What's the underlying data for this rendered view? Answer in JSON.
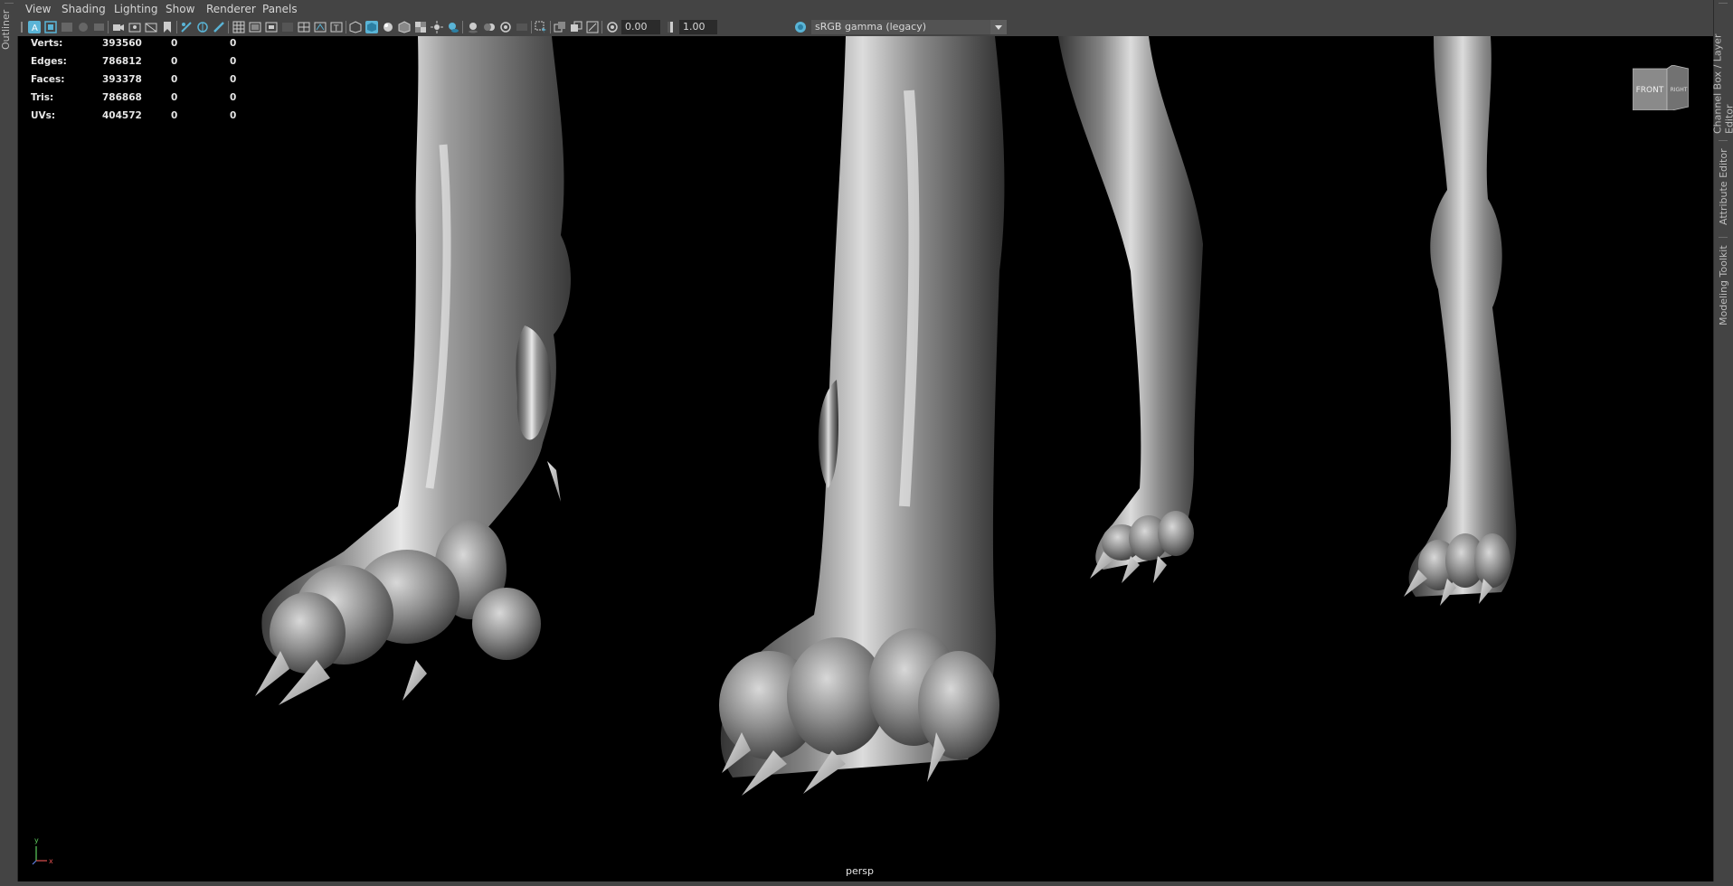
{
  "left_panel": {
    "outliner_label": "Outliner"
  },
  "right_panel": {
    "tabs": [
      {
        "label": "Channel Box / Layer Editor"
      },
      {
        "label": "Attribute Editor"
      },
      {
        "label": "Modeling Toolkit"
      }
    ]
  },
  "menubar": {
    "items": [
      {
        "label": "View"
      },
      {
        "label": "Shading"
      },
      {
        "label": "Lighting"
      },
      {
        "label": "Show"
      },
      {
        "label": "Renderer"
      },
      {
        "label": "Panels"
      }
    ]
  },
  "toolbar": {
    "exposure_value": "0.00",
    "gamma_value": "1.00",
    "color_space": "sRGB gamma (legacy)",
    "accent_color": "#5ab4d6"
  },
  "hud": {
    "rows": [
      {
        "label": "Verts:",
        "total": "393560",
        "selected": "0",
        "components": "0"
      },
      {
        "label": "Edges:",
        "total": "786812",
        "selected": "0",
        "components": "0"
      },
      {
        "label": "Faces:",
        "total": "393378",
        "selected": "0",
        "components": "0"
      },
      {
        "label": "Tris:",
        "total": "786868",
        "selected": "0",
        "components": "0"
      },
      {
        "label": "UVs:",
        "total": "404572",
        "selected": "0",
        "components": "0"
      }
    ]
  },
  "viewcube": {
    "front_label": "FRONT",
    "right_label": "RIGHT"
  },
  "camera": {
    "name": "persp"
  },
  "axis_gizmo": {
    "y_label": "y",
    "x_label": "x"
  }
}
